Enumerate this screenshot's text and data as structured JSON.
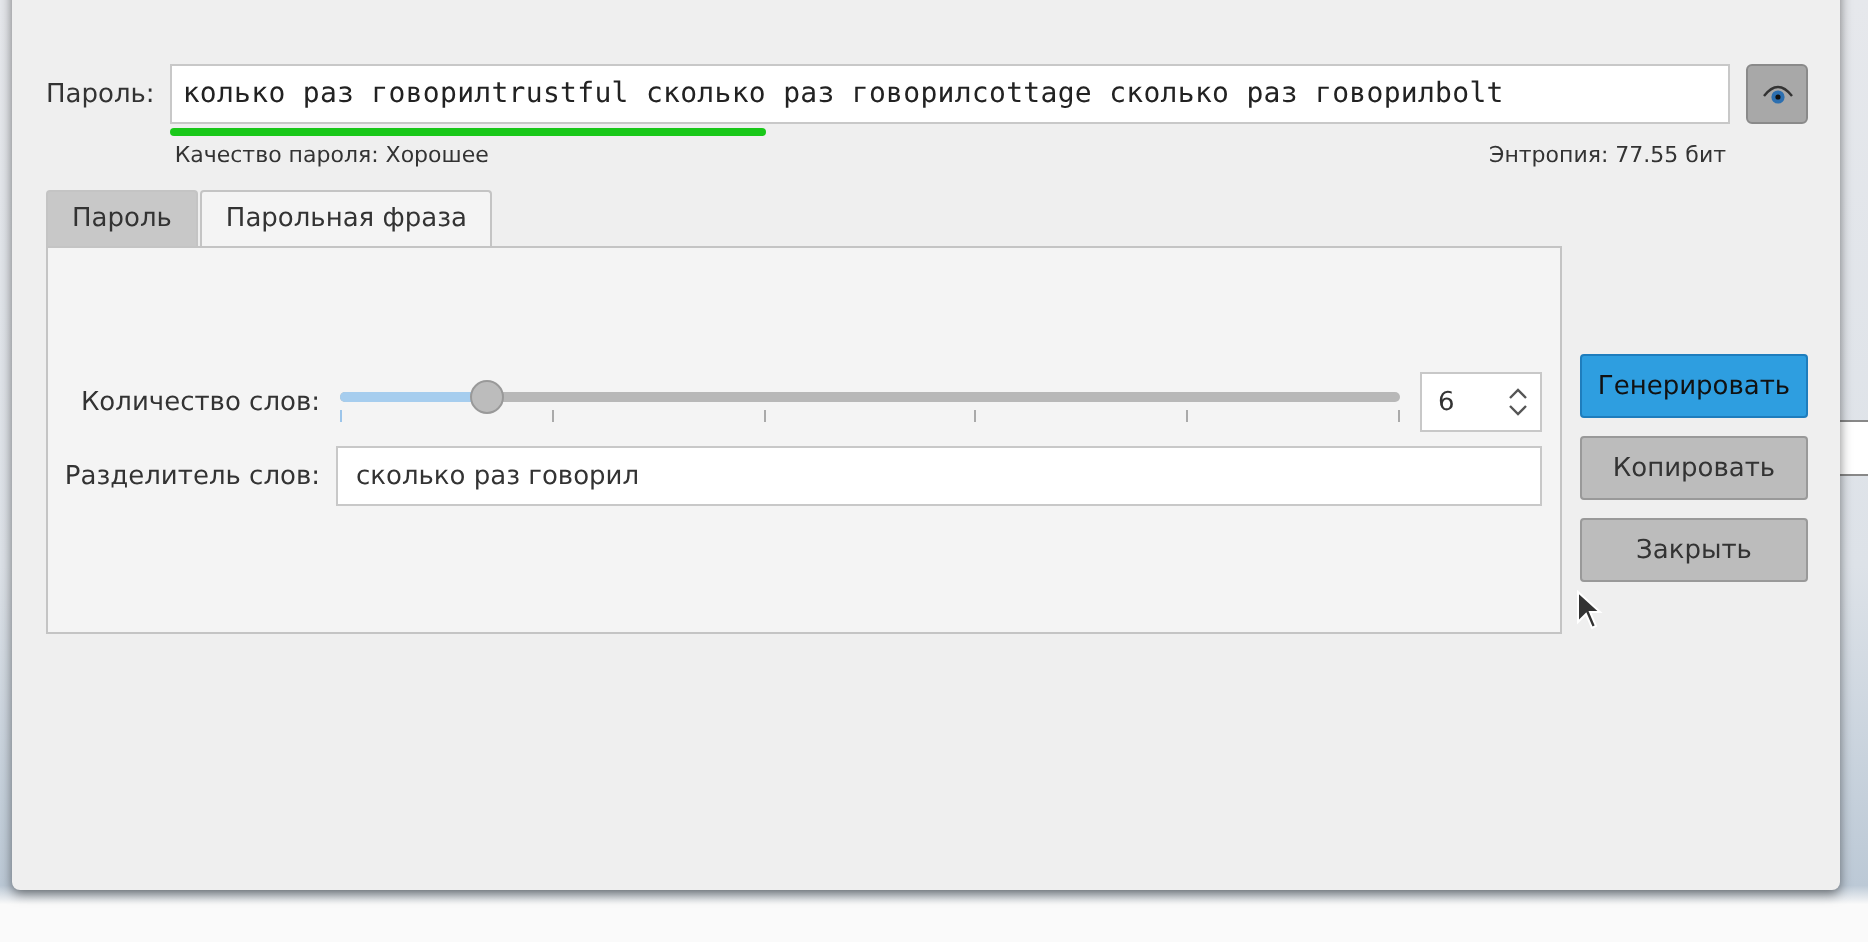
{
  "password": {
    "label": "Пароль:",
    "value": "колько раз говорилtrustful сколько раз говорилcottage сколько раз говорилbolt",
    "quality": "Качество пароля: Хорошее",
    "entropy": "Энтропия: 77.55 бит"
  },
  "tabs": [
    {
      "label": "Пароль",
      "selected": false
    },
    {
      "label": "Парольная фраза",
      "selected": true
    }
  ],
  "word_count": {
    "label": "Количество слов:",
    "level": 0.137,
    "value": "6"
  },
  "separator": {
    "label": "Разделитель слов:",
    "value": "сколько раз говорил"
  },
  "buttons": [
    {
      "label": "Генерировать",
      "kind": "primary"
    },
    {
      "label": "Копировать",
      "kind": "default"
    },
    {
      "label": "Закрыть",
      "kind": "default"
    }
  ]
}
